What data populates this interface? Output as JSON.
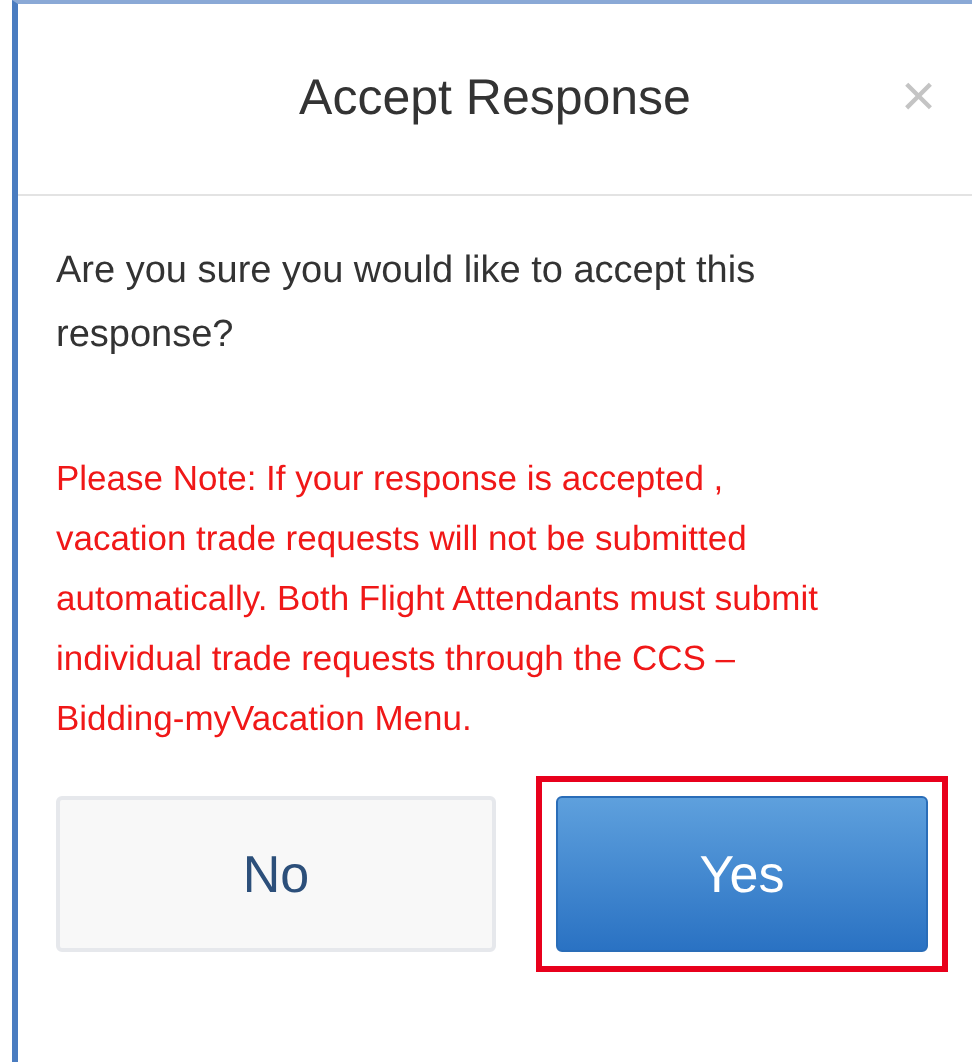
{
  "dialog": {
    "title": "Accept Response",
    "close": "×"
  },
  "question": "Are you sure you would like to accept this response?",
  "note": "Please Note: If your response is accepted , vacation trade requests will not be submitted automatically. Both Flight Attendants must submit individual trade requests through the CCS – Bidding-myVacation Menu.",
  "buttons": [
    {
      "label": "No",
      "kind": "secondary",
      "highlighted": false
    },
    {
      "label": "Yes",
      "kind": "primary",
      "highlighted": true
    }
  ]
}
